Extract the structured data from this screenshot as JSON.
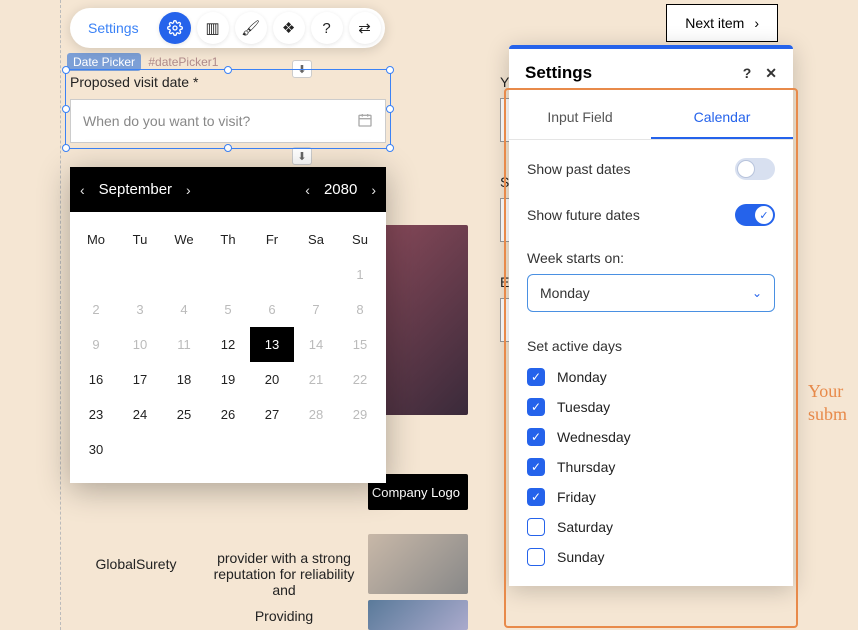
{
  "toolbar": {
    "settings_label": "Settings"
  },
  "next_item": "Next item",
  "dp_badge": {
    "tag": "Date Picker",
    "id": "#datePicker1"
  },
  "field_label": "Proposed visit date *",
  "input_placeholder": "When do you want to visit?",
  "calendar": {
    "month": "September",
    "year": "2080",
    "dow": [
      "Mo",
      "Tu",
      "We",
      "Th",
      "Fr",
      "Sa",
      "Su"
    ],
    "days": [
      {
        "n": "",
        "d": false
      },
      {
        "n": "",
        "d": false
      },
      {
        "n": "",
        "d": false
      },
      {
        "n": "",
        "d": false
      },
      {
        "n": "",
        "d": false
      },
      {
        "n": "",
        "d": false
      },
      {
        "n": "1",
        "d": true
      },
      {
        "n": "2",
        "d": true
      },
      {
        "n": "3",
        "d": true
      },
      {
        "n": "4",
        "d": true
      },
      {
        "n": "5",
        "d": true
      },
      {
        "n": "6",
        "d": true
      },
      {
        "n": "7",
        "d": true
      },
      {
        "n": "8",
        "d": true
      },
      {
        "n": "9",
        "d": true
      },
      {
        "n": "10",
        "d": true
      },
      {
        "n": "11",
        "d": true
      },
      {
        "n": "12",
        "d": false
      },
      {
        "n": "13",
        "d": false,
        "sel": true
      },
      {
        "n": "14",
        "d": true
      },
      {
        "n": "15",
        "d": true
      },
      {
        "n": "16",
        "d": false
      },
      {
        "n": "17",
        "d": false
      },
      {
        "n": "18",
        "d": false
      },
      {
        "n": "19",
        "d": false
      },
      {
        "n": "20",
        "d": false
      },
      {
        "n": "21",
        "d": true
      },
      {
        "n": "22",
        "d": true
      },
      {
        "n": "23",
        "d": false
      },
      {
        "n": "24",
        "d": false
      },
      {
        "n": "25",
        "d": false
      },
      {
        "n": "26",
        "d": false
      },
      {
        "n": "27",
        "d": false
      },
      {
        "n": "28",
        "d": true
      },
      {
        "n": "29",
        "d": true
      },
      {
        "n": "30",
        "d": false
      }
    ]
  },
  "settings": {
    "title": "Settings",
    "tabs": {
      "input": "Input Field",
      "calendar": "Calendar"
    },
    "show_past": "Show past dates",
    "show_future": "Show future dates",
    "week_start_label": "Week starts on:",
    "week_start_value": "Monday",
    "active_days_label": "Set active days",
    "days": [
      {
        "name": "Monday",
        "on": true
      },
      {
        "name": "Tuesday",
        "on": true
      },
      {
        "name": "Wednesday",
        "on": true
      },
      {
        "name": "Thursday",
        "on": true
      },
      {
        "name": "Friday",
        "on": true
      },
      {
        "name": "Saturday",
        "on": false
      },
      {
        "name": "Sunday",
        "on": false
      }
    ]
  },
  "bg": {
    "company_logo": "Company Logo",
    "global_surety": "GlobalSurety",
    "blurb": "provider with a strong reputation for reliability and",
    "blurb2": "Providing"
  },
  "faded": {
    "l1": "Your",
    "l2": "subm"
  },
  "bg_labels": {
    "y": "Y",
    "s": "S",
    "e": "E"
  }
}
